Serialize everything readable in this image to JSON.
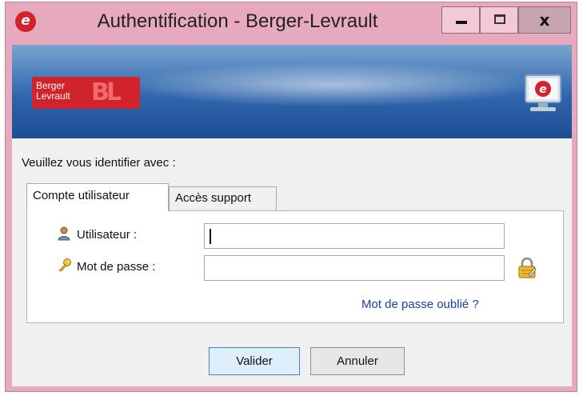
{
  "window": {
    "title": "Authentification - Berger-Levrault",
    "app_icon": "berger-levrault-e-icon",
    "close_label": "x"
  },
  "banner": {
    "logo_line1": "Berger",
    "logo_line2": "Levrault",
    "logo_mark": "BL",
    "product_icon": "computer-e-icon"
  },
  "form": {
    "prompt": "Veuillez vous identifier avec :",
    "tabs": [
      {
        "label": "Compte utilisateur",
        "selected": true
      },
      {
        "label": "Accès support",
        "selected": false
      }
    ],
    "user_label": "Utilisateur :",
    "user_value": "",
    "password_label": "Mot de passe :",
    "password_value": "",
    "forgot_link": "Mot de passe oublié ?"
  },
  "buttons": {
    "ok": "Valider",
    "cancel": "Annuler"
  },
  "colors": {
    "window_frame": "#e6a9bd",
    "banner_blue": "#2f66ad",
    "brand_red": "#d0232b",
    "link_blue": "#1a3fa5"
  }
}
